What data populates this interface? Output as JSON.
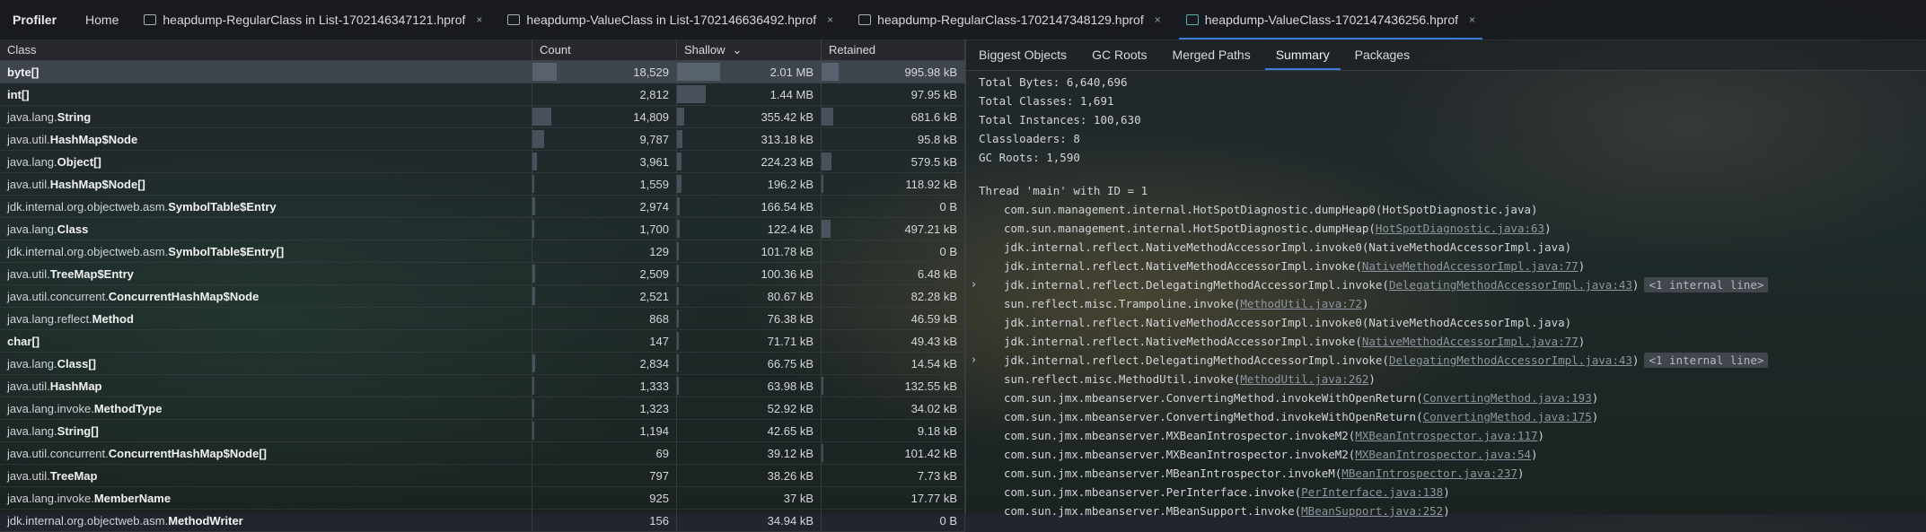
{
  "tabbar": {
    "title": "Profiler",
    "tabs": [
      {
        "label": "Home",
        "icon": null,
        "closable": false,
        "active": false
      },
      {
        "label": "heapdump-RegularClass in List-1702146347121.hprof",
        "icon": "file-icon",
        "closable": true,
        "active": false
      },
      {
        "label": "heapdump-ValueClass in List-1702146636492.hprof",
        "icon": "file-icon",
        "closable": true,
        "active": false
      },
      {
        "label": "heapdump-RegularClass-1702147348129.hprof",
        "icon": "file-icon",
        "closable": true,
        "active": false
      },
      {
        "label": "heapdump-ValueClass-1702147436256.hprof",
        "icon": "file-icon",
        "closable": true,
        "active": true
      }
    ],
    "close_glyph": "×"
  },
  "table": {
    "headers": {
      "class": "Class",
      "count": "Count",
      "shallow": "Shallow",
      "retained": "Retained"
    },
    "sort_indicator": "⌄",
    "rows": [
      {
        "pkg": "",
        "name": "byte[]",
        "count": "18,529",
        "shallow": "2.01 MB",
        "retained": "995.98 kB",
        "count_frac": 0.17,
        "shallow_frac": 0.3,
        "retained_frac": 0.12
      },
      {
        "pkg": "",
        "name": "int[]",
        "count": "2,812",
        "shallow": "1.44 MB",
        "retained": "97.95 kB",
        "count_frac": 0.0,
        "shallow_frac": 0.2,
        "retained_frac": 0.0
      },
      {
        "pkg": "java.lang.",
        "name": "String",
        "count": "14,809",
        "shallow": "355.42 kB",
        "retained": "681.6 kB",
        "count_frac": 0.13,
        "shallow_frac": 0.05,
        "retained_frac": 0.08
      },
      {
        "pkg": "java.util.",
        "name": "HashMap$Node",
        "count": "9,787",
        "shallow": "313.18 kB",
        "retained": "95.8 kB",
        "count_frac": 0.08,
        "shallow_frac": 0.04,
        "retained_frac": 0.0
      },
      {
        "pkg": "java.lang.",
        "name": "Object[]",
        "count": "3,961",
        "shallow": "224.23 kB",
        "retained": "579.5 kB",
        "count_frac": 0.03,
        "shallow_frac": 0.03,
        "retained_frac": 0.07
      },
      {
        "pkg": "java.util.",
        "name": "HashMap$Node[]",
        "count": "1,559",
        "shallow": "196.2 kB",
        "retained": "118.92 kB",
        "count_frac": 0.01,
        "shallow_frac": 0.03,
        "retained_frac": 0.01
      },
      {
        "pkg": "jdk.internal.org.objectweb.asm.",
        "name": "SymbolTable$Entry",
        "count": "2,974",
        "shallow": "166.54 kB",
        "retained": "0 B",
        "count_frac": 0.02,
        "shallow_frac": 0.02,
        "retained_frac": 0.0
      },
      {
        "pkg": "java.lang.",
        "name": "Class",
        "count": "1,700",
        "shallow": "122.4 kB",
        "retained": "497.21 kB",
        "count_frac": 0.01,
        "shallow_frac": 0.02,
        "retained_frac": 0.06
      },
      {
        "pkg": "jdk.internal.org.objectweb.asm.",
        "name": "SymbolTable$Entry[]",
        "count": "129",
        "shallow": "101.78 kB",
        "retained": "0 B",
        "count_frac": 0.0,
        "shallow_frac": 0.01,
        "retained_frac": 0.0
      },
      {
        "pkg": "java.util.",
        "name": "TreeMap$Entry",
        "count": "2,509",
        "shallow": "100.36 kB",
        "retained": "6.48 kB",
        "count_frac": 0.02,
        "shallow_frac": 0.01,
        "retained_frac": 0.0
      },
      {
        "pkg": "java.util.concurrent.",
        "name": "ConcurrentHashMap$Node",
        "count": "2,521",
        "shallow": "80.67 kB",
        "retained": "82.28 kB",
        "count_frac": 0.02,
        "shallow_frac": 0.01,
        "retained_frac": 0.0
      },
      {
        "pkg": "java.lang.reflect.",
        "name": "Method",
        "count": "868",
        "shallow": "76.38 kB",
        "retained": "46.59 kB",
        "count_frac": 0.0,
        "shallow_frac": 0.01,
        "retained_frac": 0.0
      },
      {
        "pkg": "",
        "name": "char[]",
        "count": "147",
        "shallow": "71.71 kB",
        "retained": "49.43 kB",
        "count_frac": 0.0,
        "shallow_frac": 0.01,
        "retained_frac": 0.0
      },
      {
        "pkg": "java.lang.",
        "name": "Class[]",
        "count": "2,834",
        "shallow": "66.75 kB",
        "retained": "14.54 kB",
        "count_frac": 0.02,
        "shallow_frac": 0.01,
        "retained_frac": 0.0
      },
      {
        "pkg": "java.util.",
        "name": "HashMap",
        "count": "1,333",
        "shallow": "63.98 kB",
        "retained": "132.55 kB",
        "count_frac": 0.01,
        "shallow_frac": 0.01,
        "retained_frac": 0.01
      },
      {
        "pkg": "java.lang.invoke.",
        "name": "MethodType",
        "count": "1,323",
        "shallow": "52.92 kB",
        "retained": "34.02 kB",
        "count_frac": 0.01,
        "shallow_frac": 0.0,
        "retained_frac": 0.0
      },
      {
        "pkg": "java.lang.",
        "name": "String[]",
        "count": "1,194",
        "shallow": "42.65 kB",
        "retained": "9.18 kB",
        "count_frac": 0.01,
        "shallow_frac": 0.0,
        "retained_frac": 0.0
      },
      {
        "pkg": "java.util.concurrent.",
        "name": "ConcurrentHashMap$Node[]",
        "count": "69",
        "shallow": "39.12 kB",
        "retained": "101.42 kB",
        "count_frac": 0.0,
        "shallow_frac": 0.0,
        "retained_frac": 0.01
      },
      {
        "pkg": "java.util.",
        "name": "TreeMap",
        "count": "797",
        "shallow": "38.26 kB",
        "retained": "7.73 kB",
        "count_frac": 0.0,
        "shallow_frac": 0.0,
        "retained_frac": 0.0
      },
      {
        "pkg": "java.lang.invoke.",
        "name": "MemberName",
        "count": "925",
        "shallow": "37 kB",
        "retained": "17.77 kB",
        "count_frac": 0.0,
        "shallow_frac": 0.0,
        "retained_frac": 0.0
      },
      {
        "pkg": "jdk.internal.org.objectweb.asm.",
        "name": "MethodWriter",
        "count": "156",
        "shallow": "34.94 kB",
        "retained": "0 B",
        "count_frac": 0.0,
        "shallow_frac": 0.0,
        "retained_frac": 0.0
      }
    ]
  },
  "right": {
    "tabs": [
      "Biggest Objects",
      "GC Roots",
      "Merged Paths",
      "Summary",
      "Packages"
    ],
    "active_tab": "Summary",
    "summary": [
      "Total Bytes: 6,640,696",
      "Total Classes: 1,691",
      "Total Instances: 100,630",
      "Classloaders: 8",
      "GC Roots: 1,590"
    ],
    "thread_header": "Thread 'main' with ID = 1",
    "frames": [
      {
        "pre": "com.sun.management.internal.HotSpotDiagnostic.dumpHeap0(HotSpotDiagnostic.java)",
        "link": "",
        "post": "",
        "expand": false,
        "internal": ""
      },
      {
        "pre": "com.sun.management.internal.HotSpotDiagnostic.dumpHeap(",
        "link": "HotSpotDiagnostic.java:63",
        "post": ")",
        "expand": false,
        "internal": ""
      },
      {
        "pre": "jdk.internal.reflect.NativeMethodAccessorImpl.invoke0(NativeMethodAccessorImpl.java)",
        "link": "",
        "post": "",
        "expand": false,
        "internal": ""
      },
      {
        "pre": "jdk.internal.reflect.NativeMethodAccessorImpl.invoke(",
        "link": "NativeMethodAccessorImpl.java:77",
        "post": ")",
        "expand": false,
        "internal": ""
      },
      {
        "pre": "jdk.internal.reflect.DelegatingMethodAccessorImpl.invoke(",
        "link": "DelegatingMethodAccessorImpl.java:43",
        "post": ")",
        "expand": true,
        "internal": "<1 internal line>"
      },
      {
        "pre": "sun.reflect.misc.Trampoline.invoke(",
        "link": "MethodUtil.java:72",
        "post": ")",
        "expand": false,
        "internal": ""
      },
      {
        "pre": "jdk.internal.reflect.NativeMethodAccessorImpl.invoke0(NativeMethodAccessorImpl.java)",
        "link": "",
        "post": "",
        "expand": false,
        "internal": ""
      },
      {
        "pre": "jdk.internal.reflect.NativeMethodAccessorImpl.invoke(",
        "link": "NativeMethodAccessorImpl.java:77",
        "post": ")",
        "expand": false,
        "internal": ""
      },
      {
        "pre": "jdk.internal.reflect.DelegatingMethodAccessorImpl.invoke(",
        "link": "DelegatingMethodAccessorImpl.java:43",
        "post": ")",
        "expand": true,
        "internal": "<1 internal line>"
      },
      {
        "pre": "sun.reflect.misc.MethodUtil.invoke(",
        "link": "MethodUtil.java:262",
        "post": ")",
        "expand": false,
        "internal": ""
      },
      {
        "pre": "com.sun.jmx.mbeanserver.ConvertingMethod.invokeWithOpenReturn(",
        "link": "ConvertingMethod.java:193",
        "post": ")",
        "expand": false,
        "internal": ""
      },
      {
        "pre": "com.sun.jmx.mbeanserver.ConvertingMethod.invokeWithOpenReturn(",
        "link": "ConvertingMethod.java:175",
        "post": ")",
        "expand": false,
        "internal": ""
      },
      {
        "pre": "com.sun.jmx.mbeanserver.MXBeanIntrospector.invokeM2(",
        "link": "MXBeanIntrospector.java:117",
        "post": ")",
        "expand": false,
        "internal": ""
      },
      {
        "pre": "com.sun.jmx.mbeanserver.MXBeanIntrospector.invokeM2(",
        "link": "MXBeanIntrospector.java:54",
        "post": ")",
        "expand": false,
        "internal": ""
      },
      {
        "pre": "com.sun.jmx.mbeanserver.MBeanIntrospector.invokeM(",
        "link": "MBeanIntrospector.java:237",
        "post": ")",
        "expand": false,
        "internal": ""
      },
      {
        "pre": "com.sun.jmx.mbeanserver.PerInterface.invoke(",
        "link": "PerInterface.java:138",
        "post": ")",
        "expand": false,
        "internal": ""
      },
      {
        "pre": "com.sun.jmx.mbeanserver.MBeanSupport.invoke(",
        "link": "MBeanSupport.java:252",
        "post": ")",
        "expand": false,
        "internal": ""
      }
    ],
    "expand_glyph": "›"
  },
  "colors": {
    "accent": "#3d7cd8",
    "file_icon_active": "#4fb3b0"
  }
}
